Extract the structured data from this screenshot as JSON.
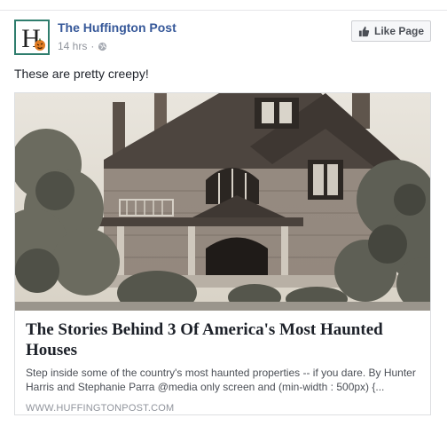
{
  "post": {
    "page_name": "The Huffington Post",
    "time": "14 hrs",
    "separator": "·",
    "privacy_icon": "globe-icon",
    "message": "These are pretty creepy!"
  },
  "avatar": {
    "letter": "H",
    "icon": "huffington-post-logo",
    "accent": "#2f7d6d"
  },
  "like_button": {
    "label": "Like Page",
    "icon": "thumbs-up-icon"
  },
  "link": {
    "image_alt": "photo-of-victorian-stone-house",
    "title": "The Stories Behind 3 Of America's Most Haunted Houses",
    "description": "Step inside some of the country's most haunted properties -- if you dare. By Hunter Harris and Stephanie Parra @media only screen and (min-width : 500px) {...",
    "domain": "WWW.HUFFINGTONPOST.COM"
  },
  "colors": {
    "link_blue": "#365899",
    "meta_gray": "#90949c",
    "border": "#dddfe2"
  }
}
